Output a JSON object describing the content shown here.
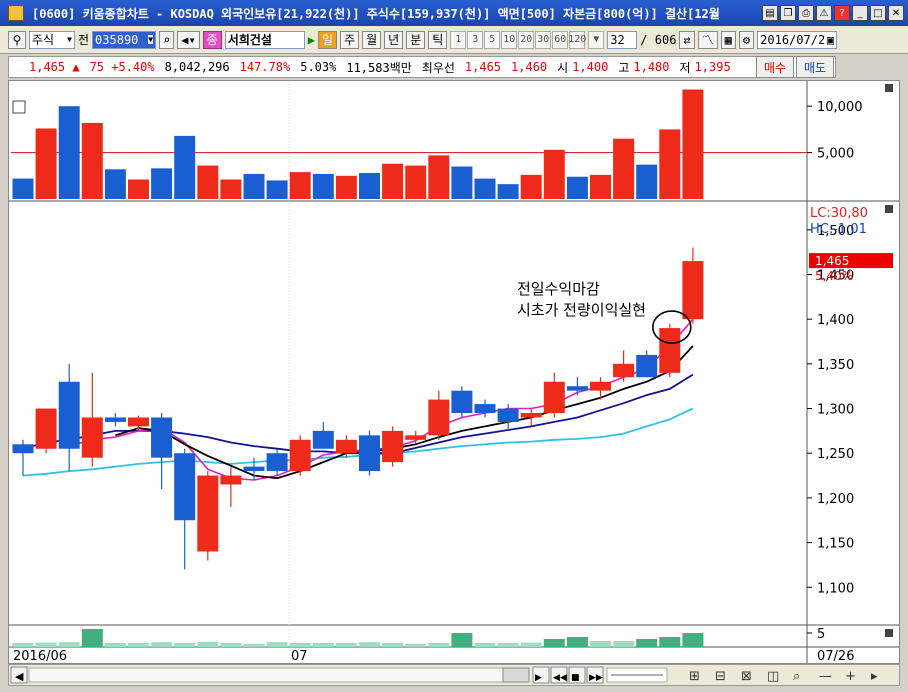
{
  "window": {
    "title": "[0600] 키움종합차트 - KOSDAQ 외국인보유[21,922(천)] 주식수[159,937(천)] 액면[500] 자본금[800(억)] 결산[12월"
  },
  "toolbar": {
    "type_label": "주식",
    "type_prefix": "전",
    "code": "035890",
    "stock_tag": "종",
    "stock_name": "서희건설",
    "period_day": "일",
    "period_week": "주",
    "period_month": "월",
    "period_year": "년",
    "period_minute": "분",
    "period_tick": "틱",
    "intervals": [
      "1",
      "3",
      "5",
      "10",
      "20",
      "30",
      "60",
      "120"
    ],
    "count": "32",
    "total": "/ 606",
    "date": "2016/07/2"
  },
  "quote": {
    "price": "1,465 ▲",
    "change": "75 +5.40%",
    "volume": "8,042,296",
    "vol_ratio": "147.78%",
    "turnover": "5.03%",
    "amount": "11,583백만",
    "best_label": "최우선",
    "best_ask": "1,465",
    "best_bid": "1,460",
    "open_label": "시",
    "open": "1,400",
    "high_label": "고",
    "high": "1,480",
    "low_label": "저",
    "low": "1,395",
    "buy": "매수",
    "sell": "매도"
  },
  "chart": {
    "vol_ticks": [
      "10,000",
      "5,000"
    ],
    "price_ticks": [
      "1,500",
      "1,450",
      "1,400",
      "1,350",
      "1,300",
      "1,250",
      "1,200",
      "1,150",
      "1,100"
    ],
    "lc": "LC:30,80",
    "hc": "HC:-1,01",
    "last_price_tag": "1,465",
    "last_pct_tag": "5,40%",
    "annotation_line1": "전일수익마감",
    "annotation_line2": "시초가 전량이익실현",
    "sub_tick": "5",
    "date_start": "2016/06",
    "date_mid": "07",
    "date_end": "07/26"
  },
  "chart_data": {
    "type": "candlestick",
    "price_range": [
      1060,
      1530
    ],
    "volume_range": [
      0,
      12500
    ],
    "candles": [
      {
        "o": 1260,
        "h": 1265,
        "l": 1225,
        "c": 1250
      },
      {
        "o": 1255,
        "h": 1300,
        "l": 1250,
        "c": 1300
      },
      {
        "o": 1330,
        "h": 1350,
        "l": 1230,
        "c": 1255
      },
      {
        "o": 1245,
        "h": 1340,
        "l": 1235,
        "c": 1290
      },
      {
        "o": 1290,
        "h": 1295,
        "l": 1280,
        "c": 1285
      },
      {
        "o": 1280,
        "h": 1292,
        "l": 1275,
        "c": 1290
      },
      {
        "o": 1290,
        "h": 1295,
        "l": 1210,
        "c": 1245
      },
      {
        "o": 1250,
        "h": 1255,
        "l": 1120,
        "c": 1175
      },
      {
        "o": 1140,
        "h": 1230,
        "l": 1130,
        "c": 1225
      },
      {
        "o": 1215,
        "h": 1235,
        "l": 1190,
        "c": 1225
      },
      {
        "o": 1235,
        "h": 1245,
        "l": 1220,
        "c": 1230
      },
      {
        "o": 1250,
        "h": 1255,
        "l": 1225,
        "c": 1230
      },
      {
        "o": 1230,
        "h": 1270,
        "l": 1225,
        "c": 1265
      },
      {
        "o": 1275,
        "h": 1285,
        "l": 1255,
        "c": 1255
      },
      {
        "o": 1250,
        "h": 1270,
        "l": 1245,
        "c": 1265
      },
      {
        "o": 1270,
        "h": 1275,
        "l": 1225,
        "c": 1230
      },
      {
        "o": 1240,
        "h": 1280,
        "l": 1235,
        "c": 1275
      },
      {
        "o": 1265,
        "h": 1275,
        "l": 1260,
        "c": 1270
      },
      {
        "o": 1270,
        "h": 1320,
        "l": 1265,
        "c": 1310
      },
      {
        "o": 1320,
        "h": 1325,
        "l": 1290,
        "c": 1295
      },
      {
        "o": 1305,
        "h": 1310,
        "l": 1290,
        "c": 1295
      },
      {
        "o": 1300,
        "h": 1305,
        "l": 1275,
        "c": 1285
      },
      {
        "o": 1290,
        "h": 1300,
        "l": 1280,
        "c": 1295
      },
      {
        "o": 1295,
        "h": 1340,
        "l": 1290,
        "c": 1330
      },
      {
        "o": 1325,
        "h": 1335,
        "l": 1315,
        "c": 1320
      },
      {
        "o": 1320,
        "h": 1335,
        "l": 1310,
        "c": 1330
      },
      {
        "o": 1335,
        "h": 1365,
        "l": 1330,
        "c": 1350
      },
      {
        "o": 1360,
        "h": 1365,
        "l": 1335,
        "c": 1335
      },
      {
        "o": 1340,
        "h": 1395,
        "l": 1335,
        "c": 1390
      },
      {
        "o": 1400,
        "h": 1480,
        "l": 1395,
        "c": 1465
      }
    ],
    "volumes": [
      2200,
      7600,
      10000,
      8200,
      3200,
      2100,
      3300,
      6800,
      3600,
      2100,
      2700,
      2000,
      2900,
      2700,
      2500,
      2800,
      3800,
      3600,
      4700,
      3500,
      2200,
      1600,
      2600,
      5300,
      2400,
      2600,
      6500,
      3700,
      7500,
      11800
    ],
    "volume_ref_line": 5000,
    "ma_black": [
      null,
      null,
      null,
      null,
      1270,
      1278,
      1275,
      1260,
      1247,
      1236,
      1225,
      1222,
      1230,
      1240,
      1250,
      1252,
      1255,
      1260,
      1268,
      1275,
      1280,
      1285,
      1290,
      1298,
      1305,
      1312,
      1322,
      1330,
      1342,
      1370
    ],
    "ma_magenta": [
      null,
      null,
      1258,
      1265,
      1268,
      1275,
      1278,
      1262,
      1232,
      1222,
      1220,
      1225,
      1235,
      1248,
      1252,
      1254,
      1256,
      1264,
      1280,
      1290,
      1295,
      1300,
      1300,
      1305,
      1318,
      1325,
      1335,
      1345,
      1370,
      1400
    ],
    "ma_navy": [
      1255,
      1262,
      1265,
      1270,
      1275,
      1275,
      1275,
      1272,
      1268,
      1262,
      1258,
      1255,
      1252,
      1252,
      1250,
      1250,
      1250,
      1256,
      1262,
      1268,
      1272,
      1276,
      1280,
      1285,
      1290,
      1298,
      1306,
      1315,
      1322,
      1338
    ],
    "ma_cyan": [
      1225,
      1227,
      1230,
      1232,
      1235,
      1238,
      1240,
      1242,
      1240,
      1238,
      1240,
      1242,
      1242,
      1245,
      1246,
      1248,
      1250,
      1252,
      1255,
      1258,
      1260,
      1262,
      1263,
      1265,
      1266,
      1268,
      1272,
      1280,
      1288,
      1300
    ],
    "sub_values": [
      1.0,
      1.1,
      1.2,
      4.5,
      1.0,
      1.0,
      1.2,
      1.0,
      1.3,
      1.0,
      0.8,
      1.2,
      1.0,
      1.0,
      1.0,
      1.2,
      1.0,
      0.8,
      1.0,
      3.5,
      1.0,
      1.0,
      1.1,
      2.0,
      2.5,
      1.5,
      1.5,
      2.0,
      2.5,
      3.5
    ],
    "colors": {
      "up": "#ee2a1b",
      "down": "#1a5fd2",
      "ref": "#d01010",
      "ma_black": "#000000",
      "ma_magenta": "#e020c0",
      "ma_navy": "#10109a",
      "ma_cyan": "#30c0e8"
    }
  }
}
